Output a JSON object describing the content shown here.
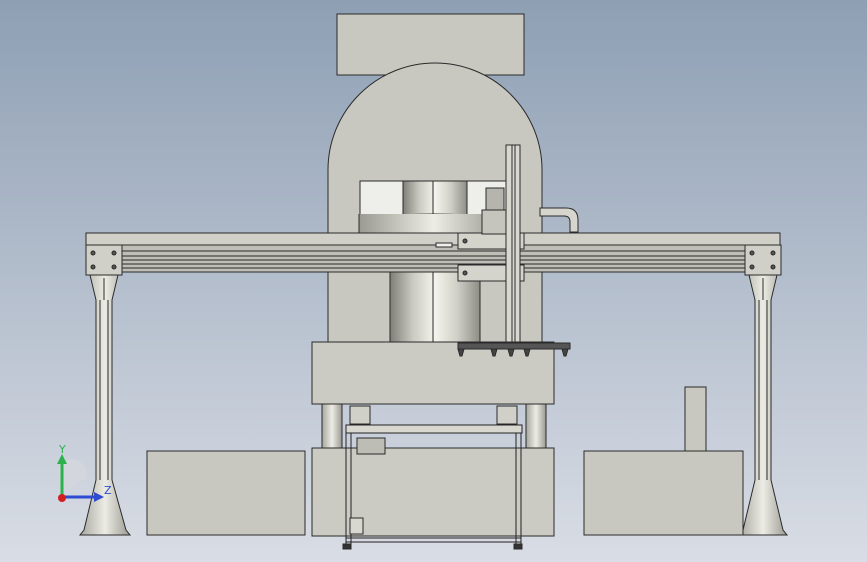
{
  "viewport": {
    "background_top": "#8e9fb4",
    "background_bottom": "#d9dde5"
  },
  "model": {
    "part_fill": "#c8c8c0",
    "part_stroke": "#2a2a2a",
    "cylinder_light": "#f2f2ea",
    "cylinder_dark": "#8a8a82"
  },
  "triad": {
    "y_label": "Y",
    "z_label": "Z",
    "y_color": "#2bb24c",
    "z_color": "#2f4bd1",
    "origin_color": "#d11f1f"
  }
}
